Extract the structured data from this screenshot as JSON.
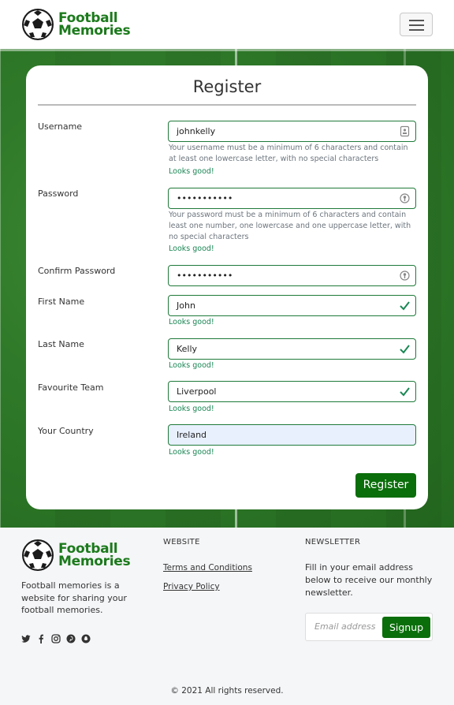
{
  "nav": {
    "brand_line1": "Football",
    "brand_line2": "Memories",
    "menu_icon": "hamburger-menu-icon"
  },
  "form": {
    "title": "Register",
    "fields": [
      {
        "label": "Username",
        "value": "johnkelly",
        "icon": "contact-card-icon",
        "help": "Your username must be a minimum of 6 characters and contain at least one lowercase letter, with no special characters",
        "valid": "Looks good!"
      },
      {
        "label": "Password",
        "value": "•••••••••••",
        "icon": "key-icon",
        "help": "Your password must be a minimum of 6 characters and contain least one number, one lowercase and one uppercase letter, with no special characters",
        "valid": "Looks good!"
      },
      {
        "label": "Confirm Password",
        "value": "•••••••••••",
        "icon": "key-icon"
      },
      {
        "label": "First Name",
        "value": "John",
        "icon": "check-icon",
        "valid": "Looks good!"
      },
      {
        "label": "Last Name",
        "value": "Kelly",
        "icon": "check-icon",
        "valid": "Looks good!"
      },
      {
        "label": "Favourite Team",
        "value": "Liverpool",
        "icon": "check-icon",
        "valid": "Looks good!"
      },
      {
        "label": "Your Country",
        "value": "Ireland",
        "valid": "Looks good!"
      }
    ],
    "submit_label": "Register"
  },
  "footer": {
    "brand_line1": "Football",
    "brand_line2": "Memories",
    "description": "Football memories is a website for sharing your football memories.",
    "social_icons": [
      "twitter-icon",
      "facebook-icon",
      "instagram-icon",
      "pinterest-icon",
      "snapchat-icon"
    ],
    "website_heading": "WEBSITE",
    "links": [
      "Terms and Conditions",
      "Privacy Policy"
    ],
    "newsletter_heading": "NEWSLETTER",
    "newsletter_text": "Fill in your email address below to receive our monthly newsletter.",
    "email_placeholder": "Email address",
    "signup_label": "Signup",
    "copyright": "© 2021 All rights reserved."
  },
  "colors": {
    "brand_green": "#1c7a1c",
    "button_green": "#0a6e0a",
    "valid_green": "#198754"
  }
}
